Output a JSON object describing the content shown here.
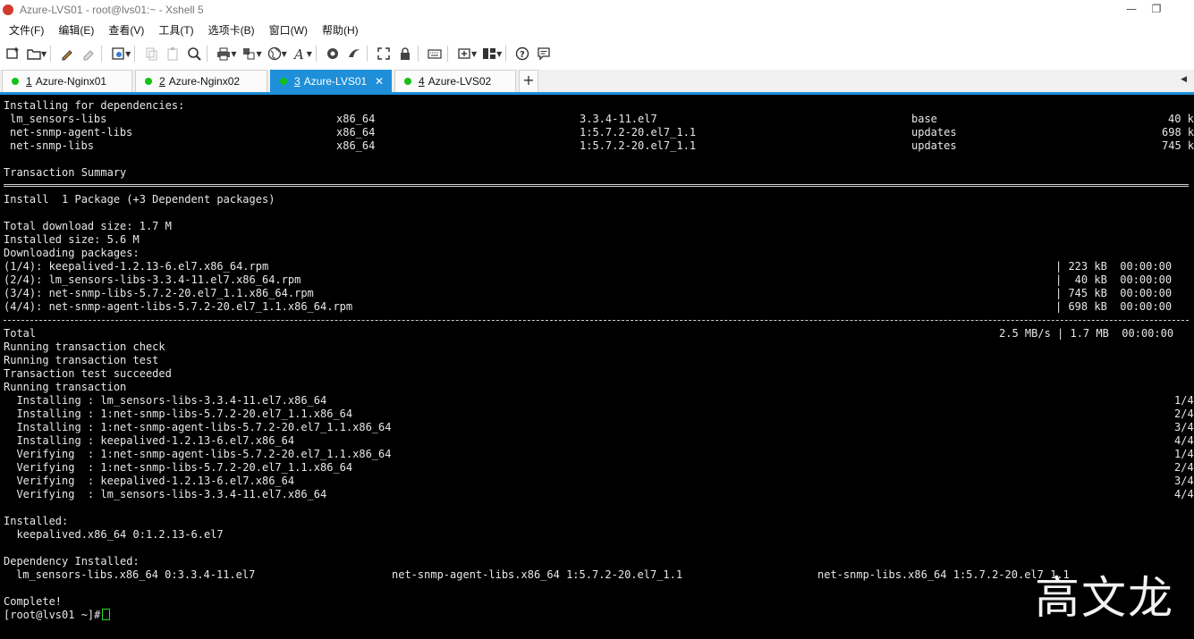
{
  "window": {
    "title": "Azure-LVS01 - root@lvs01:~ - Xshell 5",
    "minimize": "—",
    "restore": "❐"
  },
  "menu": [
    "文件(F)",
    "编辑(E)",
    "查看(V)",
    "工具(T)",
    "选项卡(B)",
    "窗口(W)",
    "帮助(H)"
  ],
  "toolbar": [
    "new-session-icon",
    "open-folder-icon",
    "paint-icon",
    "eraser-icon",
    "properties-icon",
    "copy-icon",
    "paste-icon",
    "find-icon",
    "print-icon",
    "transfer-icon",
    "globe-icon",
    "font-icon",
    "xftp-icon",
    "xftp2-icon",
    "fullscreen-icon",
    "lock-icon",
    "keyboard-icon",
    "new-tab-icon",
    "layout-icon",
    "help-icon",
    "chat-icon"
  ],
  "tabs": [
    {
      "num": "1",
      "label": "Azure-Nginx01",
      "active": false
    },
    {
      "num": "2",
      "label": "Azure-Nginx02",
      "active": false
    },
    {
      "num": "3",
      "label": "Azure-LVS01",
      "active": true
    },
    {
      "num": "4",
      "label": "Azure-LVS02",
      "active": false
    }
  ],
  "deps_header": "Installing for dependencies:",
  "deps": [
    {
      "name": "lm_sensors-libs",
      "arch": "x86_64",
      "version": "3.3.4-11.el7",
      "repo": "base",
      "size": "40 k"
    },
    {
      "name": "net-snmp-agent-libs",
      "arch": "x86_64",
      "version": "1:5.7.2-20.el7_1.1",
      "repo": "updates",
      "size": "698 k"
    },
    {
      "name": "net-snmp-libs",
      "arch": "x86_64",
      "version": "1:5.7.2-20.el7_1.1",
      "repo": "updates",
      "size": "745 k"
    }
  ],
  "summary_title": "Transaction Summary",
  "install_line": "Install  1 Package (+3 Dependent packages)",
  "download_size": "Total download size: 1.7 M",
  "installed_size": "Installed size: 5.6 M",
  "downloading": "Downloading packages:",
  "downloads": [
    {
      "file": "(1/4): keepalived-1.2.13-6.el7.x86_64.rpm",
      "size": "| 223 kB  00:00:00"
    },
    {
      "file": "(2/4): lm_sensors-libs-3.3.4-11.el7.x86_64.rpm",
      "size": "|  40 kB  00:00:00"
    },
    {
      "file": "(3/4): net-snmp-libs-5.7.2-20.el7_1.1.x86_64.rpm",
      "size": "| 745 kB  00:00:00"
    },
    {
      "file": "(4/4): net-snmp-agent-libs-5.7.2-20.el7_1.1.x86_64.rpm",
      "size": "| 698 kB  00:00:00"
    }
  ],
  "total_label": "Total",
  "total_value": "2.5 MB/s | 1.7 MB  00:00:00",
  "run_lines": [
    "Running transaction check",
    "Running transaction test",
    "Transaction test succeeded",
    "Running transaction"
  ],
  "steps": [
    {
      "text": "  Installing : lm_sensors-libs-3.3.4-11.el7.x86_64",
      "count": "1/4"
    },
    {
      "text": "  Installing : 1:net-snmp-libs-5.7.2-20.el7_1.1.x86_64",
      "count": "2/4"
    },
    {
      "text": "  Installing : 1:net-snmp-agent-libs-5.7.2-20.el7_1.1.x86_64",
      "count": "3/4"
    },
    {
      "text": "  Installing : keepalived-1.2.13-6.el7.x86_64",
      "count": "4/4"
    },
    {
      "text": "  Verifying  : 1:net-snmp-agent-libs-5.7.2-20.el7_1.1.x86_64",
      "count": "1/4"
    },
    {
      "text": "  Verifying  : 1:net-snmp-libs-5.7.2-20.el7_1.1.x86_64",
      "count": "2/4"
    },
    {
      "text": "  Verifying  : keepalived-1.2.13-6.el7.x86_64",
      "count": "3/4"
    },
    {
      "text": "  Verifying  : lm_sensors-libs-3.3.4-11.el7.x86_64",
      "count": "4/4"
    }
  ],
  "installed_header": "Installed:",
  "installed_pkg": "  keepalived.x86_64 0:1.2.13-6.el7",
  "dep_installed_header": "Dependency Installed:",
  "dep_installed": [
    "lm_sensors-libs.x86_64 0:3.3.4-11.el7",
    "net-snmp-agent-libs.x86_64 1:5.7.2-20.el7_1.1",
    "net-snmp-libs.x86_64 1:5.7.2-20.el7_1.1"
  ],
  "complete": "Complete!",
  "prompt": "[root@lvs01 ~]#",
  "watermark": "高文龙"
}
